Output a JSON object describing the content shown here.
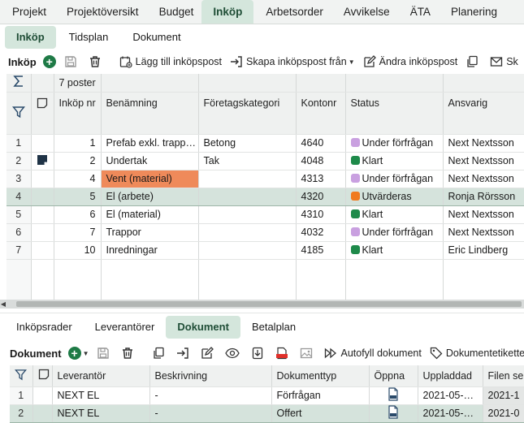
{
  "top_tabs": [
    "Projekt",
    "Projektöversikt",
    "Budget",
    "Inköp",
    "Arbetsorder",
    "Avvikelse",
    "ÄTA",
    "Planering"
  ],
  "top_tabs_active": "Inköp",
  "sub_tabs": [
    "Inköp",
    "Tidsplan",
    "Dokument"
  ],
  "sub_tabs_active": "Inköp",
  "toolbar": {
    "title": "Inköp",
    "add_label": "Lägg till inköpspost",
    "create_label": "Skapa inköpspost från",
    "edit_label": "Ändra inköpspost",
    "cut_label": "Sk"
  },
  "grid": {
    "count_label": "7 poster",
    "columns": [
      "Inköp nr",
      "Benämning",
      "Företagskategori",
      "Kontonr",
      "Status",
      "Ansvarig"
    ],
    "rows": [
      {
        "idx": "1",
        "doc": false,
        "nr": "1",
        "name": "Prefab exkl. trapp…",
        "cat": "Betong",
        "konto": "4640",
        "status": "Under förfrågan",
        "status_color": "#c9a0e0",
        "owner": "Next Nextsson"
      },
      {
        "idx": "2",
        "doc": true,
        "nr": "2",
        "name": "Undertak",
        "cat": "Tak",
        "konto": "4048",
        "status": "Klart",
        "status_color": "#1e8a4a",
        "owner": "Next Nextsson"
      },
      {
        "idx": "3",
        "doc": false,
        "nr": "4",
        "name": "Vent (material)",
        "cat": "",
        "konto": "4313",
        "status": "Under förfrågan",
        "status_color": "#c9a0e0",
        "owner": "Next Nextsson",
        "highlight": true
      },
      {
        "idx": "4",
        "doc": false,
        "nr": "5",
        "name": "El (arbete)",
        "cat": "",
        "konto": "4320",
        "status": "Utvärderas",
        "status_color": "#f07a1e",
        "owner": "Ronja Rörsson",
        "selected": true
      },
      {
        "idx": "5",
        "doc": false,
        "nr": "6",
        "name": "El (material)",
        "cat": "",
        "konto": "4310",
        "status": "Klart",
        "status_color": "#1e8a4a",
        "owner": "Next Nextsson"
      },
      {
        "idx": "6",
        "doc": false,
        "nr": "7",
        "name": "Trappor",
        "cat": "",
        "konto": "4032",
        "status": "Under förfrågan",
        "status_color": "#c9a0e0",
        "owner": "Next Nextsson"
      },
      {
        "idx": "7",
        "doc": false,
        "nr": "10",
        "name": "Inredningar",
        "cat": "",
        "konto": "4185",
        "status": "Klart",
        "status_color": "#1e8a4a",
        "owner": "Eric Lindberg"
      }
    ]
  },
  "bottom_tabs": [
    "Inköpsrader",
    "Leverantörer",
    "Dokument",
    "Betalplan"
  ],
  "bottom_tabs_active": "Dokument",
  "doc_toolbar": {
    "title": "Dokument",
    "autofill_label": "Autofyll dokument",
    "tags_label": "Dokumentetiketter"
  },
  "doc_grid": {
    "columns": [
      "Leverantör",
      "Beskrivning",
      "Dokumenttyp",
      "Öppna",
      "Uppladdad",
      "Filen se"
    ],
    "rows": [
      {
        "idx": "1",
        "supplier": "NEXT EL",
        "desc": "-",
        "type": "Förfrågan",
        "uploaded": "2021-05-…",
        "file": "2021-1"
      },
      {
        "idx": "2",
        "supplier": "NEXT EL",
        "desc": "-",
        "type": "Offert",
        "uploaded": "2021-05-…",
        "file": "2021-0",
        "selected": true
      }
    ]
  }
}
